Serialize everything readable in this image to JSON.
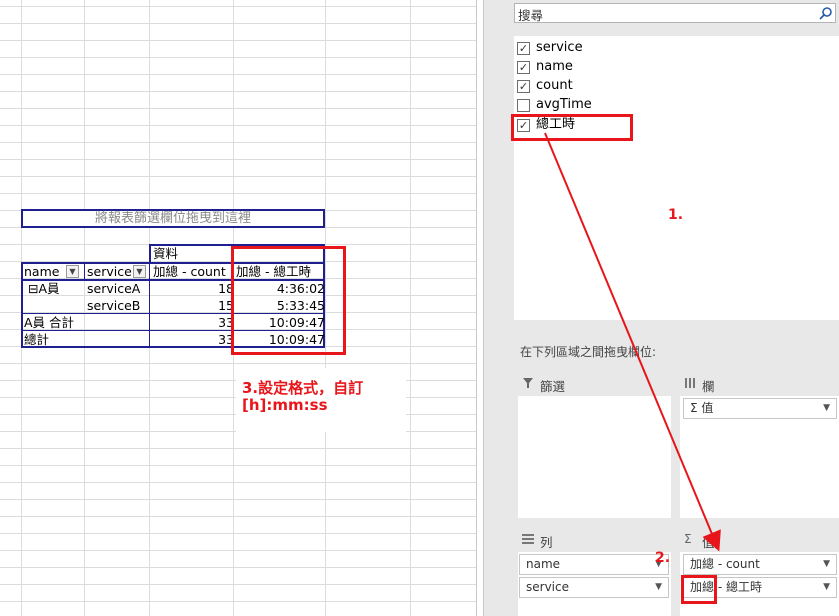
{
  "sheet": {
    "filter_drop_text": "將報表篩選欄位拖曳到這裡",
    "data_header": "資料",
    "col_headers": [
      "name",
      "service",
      "加總 - count",
      "加總 - 總工時"
    ],
    "rows": [
      {
        "name": "⊟A員",
        "service": "serviceA",
        "count": "18",
        "hours": "4:36:02"
      },
      {
        "name": "",
        "service": "serviceB",
        "count": "15",
        "hours": "5:33:45"
      },
      {
        "name": "A員 合計",
        "service": "",
        "count": "33",
        "hours": "10:09:47"
      },
      {
        "name": "總計",
        "service": "",
        "count": "33",
        "hours": "10:09:47"
      }
    ]
  },
  "annotations": {
    "step1": "1.",
    "step2": "2.",
    "step3_line1": "3.設定格式，自訂",
    "step3_line2": "[h]:mm:ss",
    "color": "#e8161b"
  },
  "panel": {
    "search_placeholder": "搜尋",
    "fields": [
      {
        "label": "service",
        "checked": true
      },
      {
        "label": "name",
        "checked": true
      },
      {
        "label": "count",
        "checked": true
      },
      {
        "label": "avgTime",
        "checked": false
      },
      {
        "label": "總工時",
        "checked": true
      }
    ],
    "drag_hint": "在下列區域之間拖曳欄位:",
    "zones": {
      "filter": {
        "title": "篩選",
        "items": []
      },
      "columns": {
        "title": "欄",
        "items": [
          "Σ 值"
        ]
      },
      "rows": {
        "title": "列",
        "items": [
          "name",
          "service"
        ]
      },
      "values": {
        "title": "值",
        "items": [
          "加總 - count",
          "加總 - 總工時"
        ]
      }
    }
  }
}
